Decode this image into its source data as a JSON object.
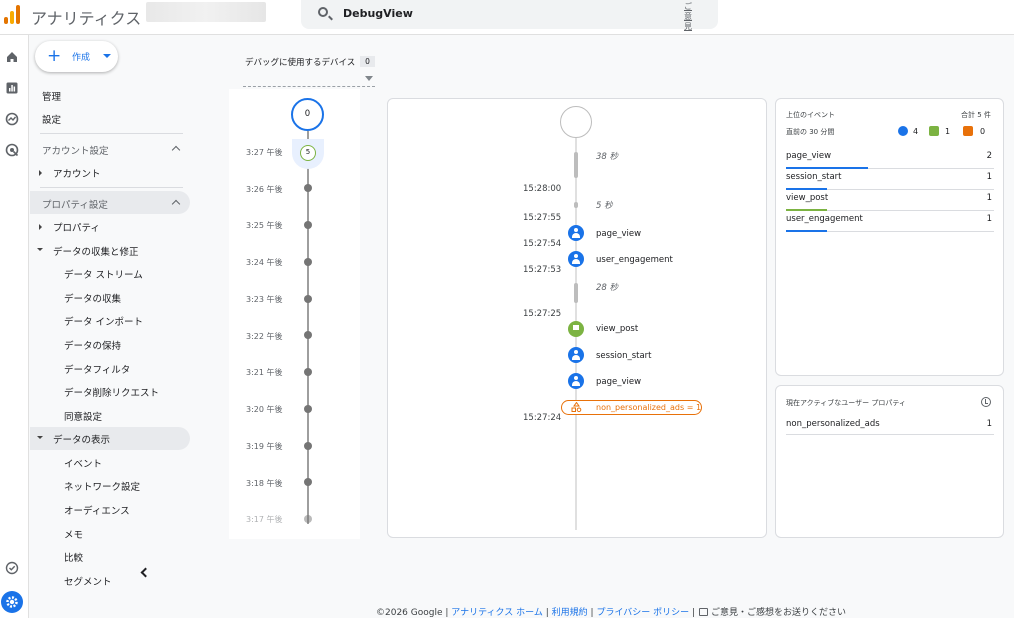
{
  "header": {
    "app_title": "アナリティクス",
    "search_text": "DebugView",
    "help_label": "ご意見"
  },
  "create_button": {
    "label": "作成"
  },
  "sidebar": {
    "top_items": [
      "管理",
      "設定"
    ],
    "account_section": "アカウント設定",
    "account_item": "アカウント",
    "property_section": "プロパティ設定",
    "property_item": "プロパティ",
    "data_collection": "データの収集と修正",
    "data_collection_items": [
      "データ ストリーム",
      "データの収集",
      "データ インポート",
      "データの保持",
      "データフィルタ",
      "データ削除リクエスト",
      "同意設定"
    ],
    "data_display": "データの表示",
    "data_display_items": [
      "イベント",
      "ネットワーク設定",
      "オーディエンス",
      "メモ",
      "比較",
      "セグメント"
    ]
  },
  "devices": {
    "label": "デバッグに使用するデバイス",
    "count": "0"
  },
  "minutes": {
    "seconds_counter": "0",
    "current_minute_count": "5",
    "labels": [
      "3:27 午後",
      "3:26 午後",
      "3:25 午後",
      "3:24 午後",
      "3:23 午後",
      "3:22 午後",
      "3:21 午後",
      "3:20 午後",
      "3:19 午後",
      "3:18 午後",
      "3:17 午後"
    ]
  },
  "stream": {
    "times": [
      "15:28:00",
      "15:27:55",
      "15:27:54",
      "15:27:53",
      "15:27:25",
      "15:27:24"
    ],
    "gaps": [
      "38 秒",
      "5 秒",
      "28 秒"
    ],
    "events": [
      {
        "name": "page_view",
        "type": "blue"
      },
      {
        "name": "user_engagement",
        "type": "blue"
      },
      {
        "name": "view_post",
        "type": "green"
      },
      {
        "name": "session_start",
        "type": "blue"
      },
      {
        "name": "page_view",
        "type": "blue"
      }
    ],
    "user_property_event": "non_personalized_ads = 1"
  },
  "top_events": {
    "title": "上位のイベント",
    "total_label": "合計 5 件",
    "subtitle": "直前の 30 分間",
    "counts": {
      "blue": "4",
      "green": "1",
      "orange": "0"
    },
    "rows": [
      {
        "name": "page_view",
        "count": "2",
        "bar_fraction": 0.4,
        "color": "#1a73e8"
      },
      {
        "name": "session_start",
        "count": "1",
        "bar_fraction": 0.2,
        "color": "#1a73e8"
      },
      {
        "name": "view_post",
        "count": "1",
        "bar_fraction": 0.2,
        "color": "#7cb342"
      },
      {
        "name": "user_engagement",
        "count": "1",
        "bar_fraction": 0.2,
        "color": "#1a73e8"
      }
    ]
  },
  "user_properties": {
    "title": "現在アクティブなユーザー プロパティ",
    "rows": [
      {
        "name": "non_personalized_ads",
        "count": "1"
      }
    ]
  },
  "footer": {
    "copyright": "©2026 Google",
    "links": [
      "アナリティクス ホーム",
      "利用規約",
      "プライバシー ポリシー"
    ],
    "feedback": "ご意見・ご感想をお送りください"
  },
  "colors": {
    "accent": "#1a73e8",
    "green": "#7cb342",
    "orange": "#e8710a"
  }
}
